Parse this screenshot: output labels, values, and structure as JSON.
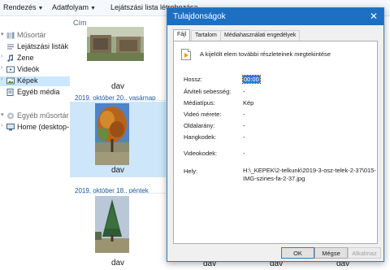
{
  "toolbar": {
    "organize_label": "Rendezés",
    "stream_label": "Adatfolyam",
    "create_playlist_label": "Lejátszási lista létrehozása"
  },
  "sidebar": {
    "items": [
      {
        "label": "Műsortár",
        "icon": "music-library-icon"
      },
      {
        "label": "Lejátszási listák",
        "icon": "playlist-icon"
      },
      {
        "label": "Zene",
        "icon": "music-note-icon"
      },
      {
        "label": "Videók",
        "icon": "video-icon"
      },
      {
        "label": "Képek",
        "icon": "pictures-icon",
        "selected": true
      },
      {
        "label": "Egyéb média",
        "icon": "other-media-icon"
      },
      {
        "label": "Egyéb műsortár",
        "icon": "other-libraries-icon"
      },
      {
        "label": "Home (desktop-",
        "icon": "home-computer-icon"
      }
    ]
  },
  "content": {
    "column_header": "Cím",
    "groups": [
      {
        "date": "",
        "caption": "dav"
      },
      {
        "date": "2019. október 20., vasárnap",
        "caption": "dav"
      },
      {
        "date": "2019. október 18., péntek",
        "caption": "dav"
      }
    ],
    "bottom_captions": [
      "dav",
      "dav",
      "dav"
    ]
  },
  "dialog": {
    "title": "Tulajdonságok",
    "close_icon": "close-icon",
    "tabs": [
      "Fájl",
      "Tartalom",
      "Médiahasználati engedélyek"
    ],
    "active_tab": "Fájl",
    "header_text": "A kijelölt elem további részleteinek megtekintése",
    "properties": {
      "length_label": "Hossz:",
      "length_value": "00:00",
      "bitrate_label": "Átviteli sebesség:",
      "bitrate_value": "-",
      "media_type_label": "Médiatípus:",
      "media_type_value": "Kép",
      "video_size_label": "Videó mérete:",
      "video_size_value": "-",
      "aspect_label": "Oldalarány:",
      "aspect_value": "-",
      "audio_codec_label": "Hangkodek:",
      "audio_codec_value": "-",
      "video_codec_label": "Videokodek:",
      "video_codec_value": "-",
      "location_label": "Hely:",
      "location_value_line1": "H:\\_KEPEK\\2-telkunk\\2019-3-osz-telek-2-37\\015-",
      "location_value_line2": "IMG-szines-fa-2-37.jpg"
    },
    "buttons": {
      "ok": "OK",
      "cancel": "Mégse",
      "apply": "Alkalmaz"
    }
  },
  "colors": {
    "accent": "#1d6fc2",
    "selection": "#cce8ff",
    "date_heading": "#1e5a9a"
  }
}
